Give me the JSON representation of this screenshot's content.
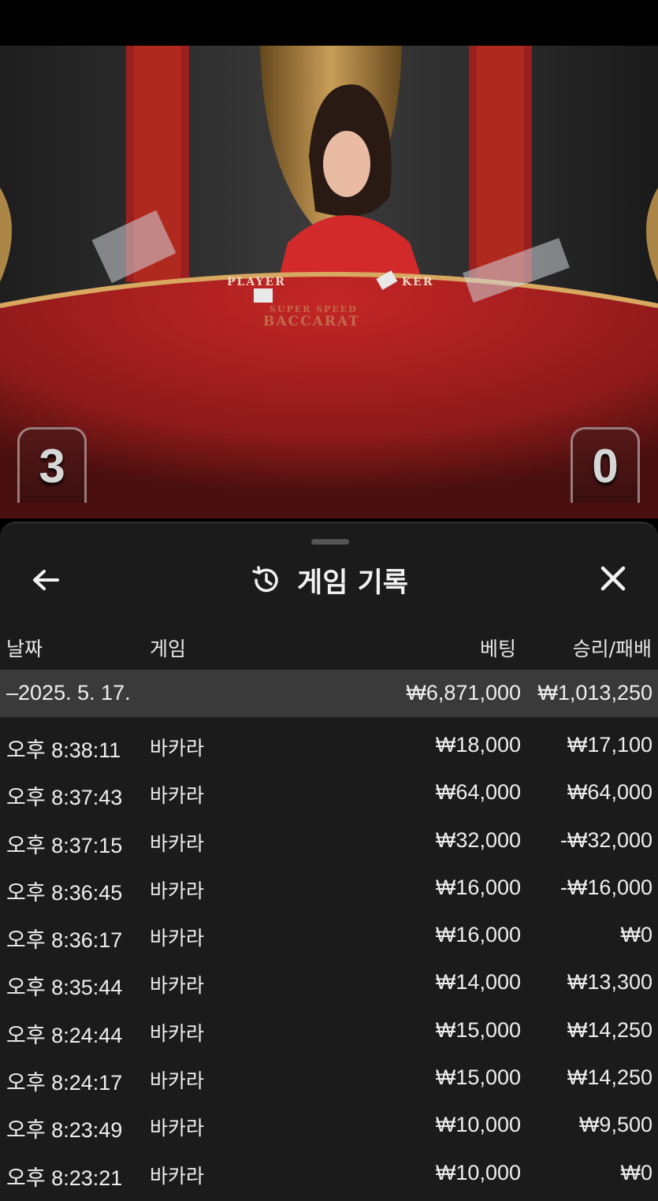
{
  "video": {
    "table_label_player": "PLAYER",
    "table_label_banker": "KER",
    "table_brand_line1": "SUPER SPEED",
    "table_brand_line2": "BACCARAT",
    "player_score": "3",
    "banker_score": "0"
  },
  "panel": {
    "title": "게임 기록",
    "icons": {
      "back": "arrow-left-icon",
      "history": "history-clock-icon",
      "close": "close-icon"
    },
    "columns": {
      "date": "날짜",
      "game": "게임",
      "bet": "베팅",
      "result": "승리/패배"
    },
    "summary": {
      "date": "–2025. 5. 17.",
      "bet": "₩6,871,000",
      "result": "₩1,013,250"
    },
    "rows": [
      {
        "time": "오후 8:38:11",
        "game": "바카라",
        "bet": "₩18,000",
        "result": "₩17,100"
      },
      {
        "time": "오후 8:37:43",
        "game": "바카라",
        "bet": "₩64,000",
        "result": "₩64,000"
      },
      {
        "time": "오후 8:37:15",
        "game": "바카라",
        "bet": "₩32,000",
        "result": "-₩32,000"
      },
      {
        "time": "오후 8:36:45",
        "game": "바카라",
        "bet": "₩16,000",
        "result": "-₩16,000"
      },
      {
        "time": "오후 8:36:17",
        "game": "바카라",
        "bet": "₩16,000",
        "result": "₩0"
      },
      {
        "time": "오후 8:35:44",
        "game": "바카라",
        "bet": "₩14,000",
        "result": "₩13,300"
      },
      {
        "time": "오후 8:24:44",
        "game": "바카라",
        "bet": "₩15,000",
        "result": "₩14,250"
      },
      {
        "time": "오후 8:24:17",
        "game": "바카라",
        "bet": "₩15,000",
        "result": "₩14,250"
      },
      {
        "time": "오후 8:23:49",
        "game": "바카라",
        "bet": "₩10,000",
        "result": "₩9,500"
      },
      {
        "time": "오후 8:23:21",
        "game": "바카라",
        "bet": "₩10,000",
        "result": "₩0"
      }
    ]
  },
  "colors": {
    "panel_bg": "#1b1b1b",
    "summary_bg": "#3a3a3a",
    "text": "#efefef",
    "table_felt": "#b52222"
  }
}
